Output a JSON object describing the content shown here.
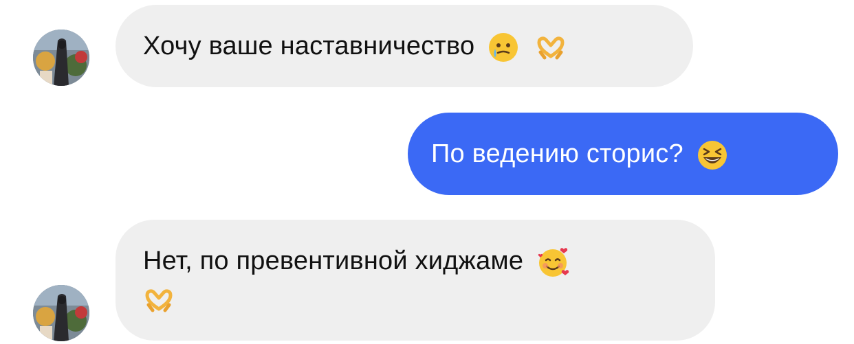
{
  "messages": [
    {
      "direction": "incoming",
      "text": "Хочу ваше наставничество",
      "emojis": [
        "face-holding-back-tears-emoji",
        "heart-hands-emoji"
      ]
    },
    {
      "direction": "outgoing",
      "text": "По ведению сторис?",
      "emojis": [
        "grinning-squinting-face-emoji"
      ]
    },
    {
      "direction": "incoming",
      "text": "Нет, по превентивной хиджаме",
      "emojis": [
        "smiling-face-with-hearts-emoji",
        "heart-hands-emoji"
      ]
    }
  ],
  "colors": {
    "incoming_bubble": "#efefef",
    "outgoing_bubble": "#3b69f5",
    "incoming_text": "#111111",
    "outgoing_text": "#ffffff"
  }
}
